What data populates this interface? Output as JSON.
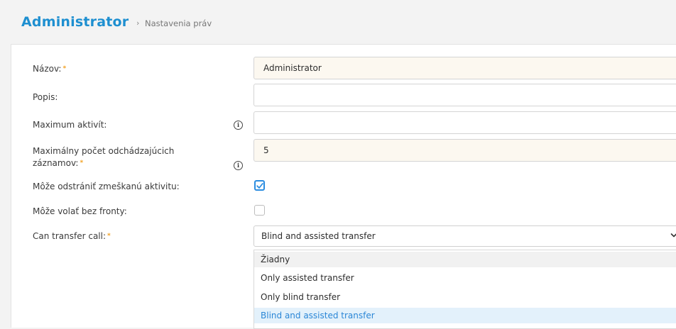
{
  "header": {
    "title": "Administrator",
    "separator": "›",
    "breadcrumb": "Nastavenia práv"
  },
  "form": {
    "name": {
      "label": "Názov:",
      "required": "*",
      "value": "Administrator"
    },
    "description": {
      "label": "Popis:",
      "value": ""
    },
    "max_activities": {
      "label": "Maximum aktivít:",
      "info_icon": "info-icon",
      "value": ""
    },
    "max_outgoing": {
      "label_line1": "Maximálny počet odchádzajúcich",
      "label_line2": "záznamov:",
      "required": "*",
      "info_icon": "info-icon",
      "value": "5"
    },
    "can_delete_missed": {
      "label": "Môže odstrániť zmeškanú aktivitu:",
      "checked": true
    },
    "can_call_without_queue": {
      "label": "Môže volať bez fronty:",
      "checked": false
    },
    "can_transfer": {
      "label": "Can transfer call:",
      "required": "*",
      "selected": "Blind and assisted transfer",
      "options": [
        "Žiadny",
        "Only assisted transfer",
        "Only blind transfer",
        "Blind and assisted transfer"
      ]
    }
  },
  "colors": {
    "accent": "#1e8fd0",
    "required": "#f2a020",
    "selected_option_bg": "#e3f1fb",
    "checkbox_border": "#2c8de0"
  }
}
